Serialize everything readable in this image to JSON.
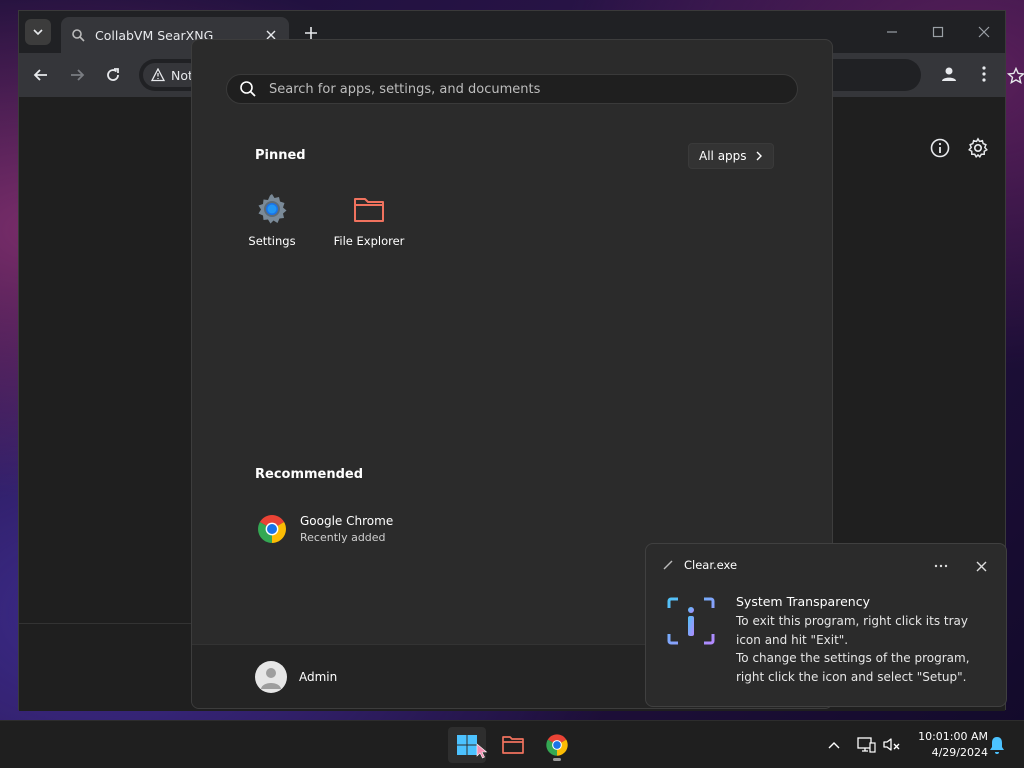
{
  "browser": {
    "tab_title": "CollabVM SearXNG",
    "security_label": "Not"
  },
  "start_menu": {
    "search_placeholder": "Search for apps, settings, and documents",
    "pinned_title": "Pinned",
    "all_apps_label": "All apps",
    "pinned": [
      {
        "label": "Settings",
        "icon": "gear-icon"
      },
      {
        "label": "File Explorer",
        "icon": "folder-icon"
      }
    ],
    "recommended_title": "Recommended",
    "recommended": [
      {
        "name": "Google Chrome",
        "sub": "Recently added",
        "icon": "chrome-icon"
      }
    ],
    "user_name": "Admin"
  },
  "toast": {
    "app_name": "Clear.exe",
    "title": "System Transparency",
    "lines": [
      "To exit this program, right click its tray",
      "icon and hit \"Exit\".",
      "To change the settings of the program,",
      "right click the icon and select \"Setup\"."
    ]
  },
  "taskbar": {
    "time": "10:01:00 AM",
    "date": "4/29/2024",
    "apps": [
      "start-icon",
      "folder-icon",
      "chrome-icon"
    ]
  },
  "colors": {
    "accent_blue": "#4cc2ff",
    "folder_orange": "#f0725e",
    "toast_icon_gradient": [
      "#4fc3f7",
      "#b388ff"
    ]
  }
}
